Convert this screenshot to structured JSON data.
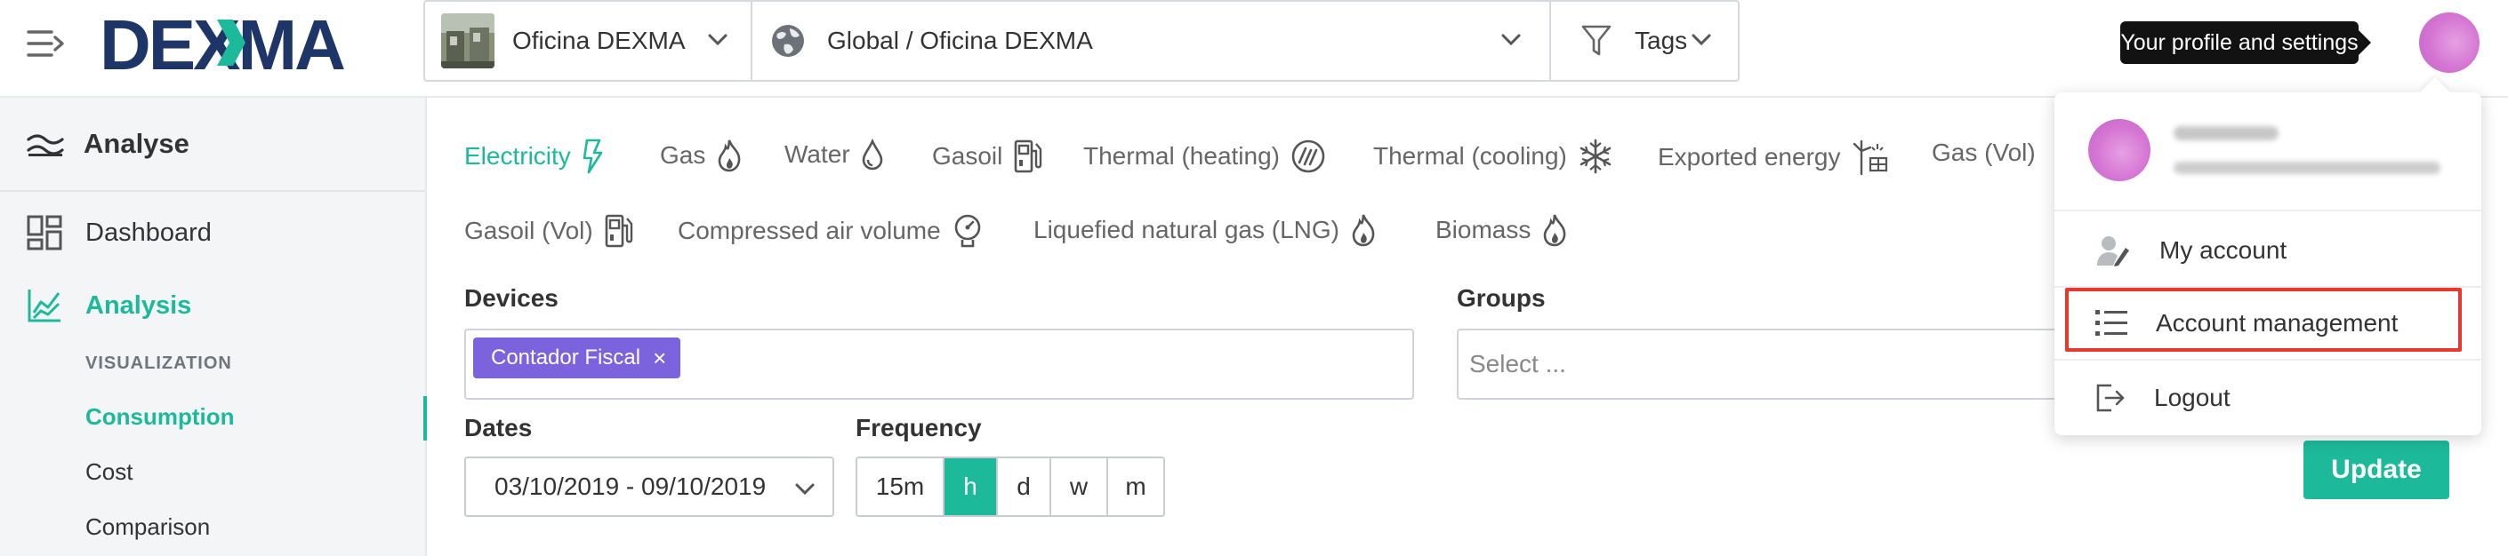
{
  "header": {
    "logo_text": "DEXMA",
    "building_selector": {
      "label": "Oficina DEXMA"
    },
    "location_selector": {
      "label": "Global / Oficina DEXMA"
    },
    "tags_selector": {
      "label": "Tags"
    },
    "profile_tooltip": "Your profile and settings"
  },
  "sidebar": {
    "header": "Analyse",
    "items": [
      {
        "label": "Dashboard"
      },
      {
        "label": "Analysis"
      }
    ],
    "section_label": "VISUALIZATION",
    "sub_items": [
      {
        "label": "Consumption"
      },
      {
        "label": "Cost"
      },
      {
        "label": "Comparison"
      }
    ]
  },
  "energy_tabs": [
    {
      "label": "Electricity",
      "icon": "lightning-icon"
    },
    {
      "label": "Gas",
      "icon": "flame-icon"
    },
    {
      "label": "Water",
      "icon": "drop-icon"
    },
    {
      "label": "Gasoil",
      "icon": "fuel-pump-icon"
    },
    {
      "label": "Thermal (heating)",
      "icon": "heating-icon"
    },
    {
      "label": "Thermal (cooling)",
      "icon": "snowflake-icon"
    },
    {
      "label": "Exported energy",
      "icon": "wind-solar-icon"
    },
    {
      "label": "Gas (Vol)",
      "icon": "flame-icon"
    },
    {
      "label": "Gasoil (Vol)",
      "icon": "fuel-pump-icon"
    },
    {
      "label": "Compressed air volume",
      "icon": "gauge-icon"
    },
    {
      "label": "Liquefied natural gas (LNG)",
      "icon": "flame-icon"
    },
    {
      "label": "Biomass",
      "icon": "flame-icon"
    }
  ],
  "filters": {
    "devices_label": "Devices",
    "devices_chip": "Contador Fiscal",
    "chip_remove": "×",
    "groups_label": "Groups",
    "groups_placeholder": "Select ...",
    "dates_label": "Dates",
    "dates_value": "03/10/2019 - 09/10/2019",
    "frequency_label": "Frequency",
    "frequency_options": [
      "15m",
      "h",
      "d",
      "w",
      "m"
    ],
    "frequency_selected": "h",
    "update_label": "Update"
  },
  "profile_menu": {
    "items": [
      {
        "label": "My account",
        "icon": "user-edit-icon"
      },
      {
        "label": "Account management",
        "icon": "list-icon"
      },
      {
        "label": "Logout",
        "icon": "logout-icon"
      }
    ]
  },
  "colors": {
    "accent": "#1db99b",
    "chip": "#7b63dd",
    "logo_navy": "#1d3667",
    "highlight": "#e8382e",
    "avatar": "#d474d3"
  }
}
